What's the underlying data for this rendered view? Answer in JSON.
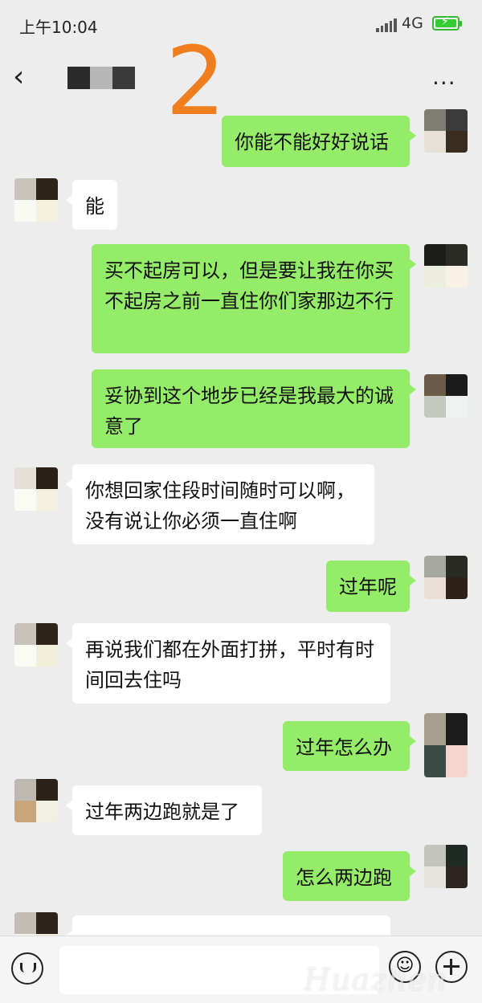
{
  "status_bar": {
    "time": "上午10:04",
    "network": "4G"
  },
  "header": {
    "overlay_number": "2",
    "more": "..."
  },
  "messages": [
    {
      "side": "me",
      "text": "你能不能好好说话"
    },
    {
      "side": "them",
      "text": "能"
    },
    {
      "side": "me",
      "text": "买不起房可以，但是要让我在你买不起房之前一直住你们家那边不行"
    },
    {
      "side": "me",
      "text": "妥协到这个地步已经是我最大的诚意了"
    },
    {
      "side": "them",
      "text": "你想回家住段时间随时可以啊，没有说让你必须一直住啊"
    },
    {
      "side": "me",
      "text": "过年呢"
    },
    {
      "side": "them",
      "text": "再说我们都在外面打拼，平时有时间回去住吗"
    },
    {
      "side": "me",
      "text": "过年怎么办"
    },
    {
      "side": "them",
      "text": "过年两边跑就是了"
    },
    {
      "side": "me",
      "text": "怎么两边跑"
    },
    {
      "side": "them",
      "text": ""
    }
  ],
  "input_bar": {
    "watermark": "Huazhen"
  },
  "colors": {
    "my_bubble": "#95ec69",
    "their_bubble": "#ffffff",
    "background": "#ededed",
    "overlay_number": "#f07e1e"
  }
}
